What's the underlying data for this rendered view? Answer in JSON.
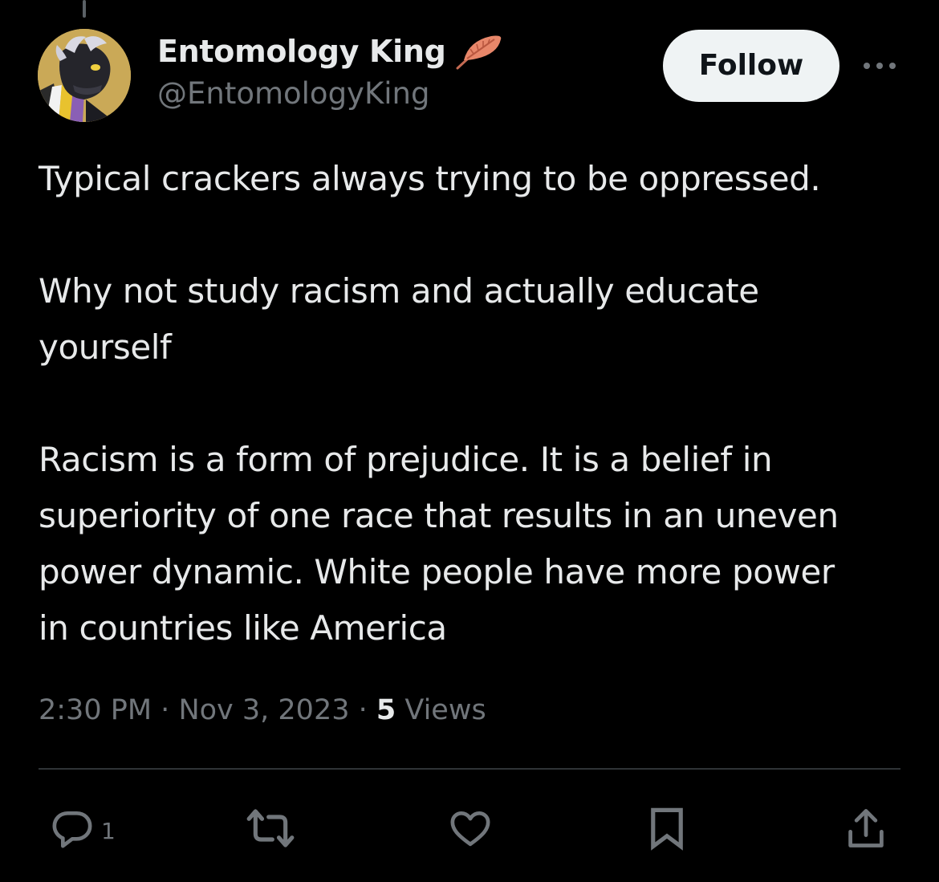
{
  "author": {
    "display_name": "Entomology King",
    "handle": "@EntomologyKing",
    "badge_icon": "feather-icon",
    "avatar_icon": "avatar"
  },
  "follow_label": "Follow",
  "more_icon": "more-icon",
  "tweet": {
    "paragraphs": [
      "Typical crackers always trying to be oppressed.",
      "Why not study racism and actually educate\nyourself",
      "Racism is a form of prejudice. It is a belief in\nsuperiority of one race that results in an uneven\npower dynamic. White people have more power\nin countries like America"
    ]
  },
  "meta": {
    "time": "2:30 PM",
    "separator": "·",
    "date": "Nov 3, 2023",
    "views_count": "5",
    "views_label": "Views"
  },
  "actions": {
    "reply_count": "1",
    "icons": [
      "reply-icon",
      "retweet-icon",
      "like-icon",
      "bookmark-icon",
      "share-icon"
    ]
  },
  "colors": {
    "background": "#000000",
    "text_primary": "#e7e9ea",
    "text_secondary": "#71767b",
    "divider": "#2f3336",
    "follow_bg": "#eff3f4",
    "feather": "#e8876a"
  }
}
